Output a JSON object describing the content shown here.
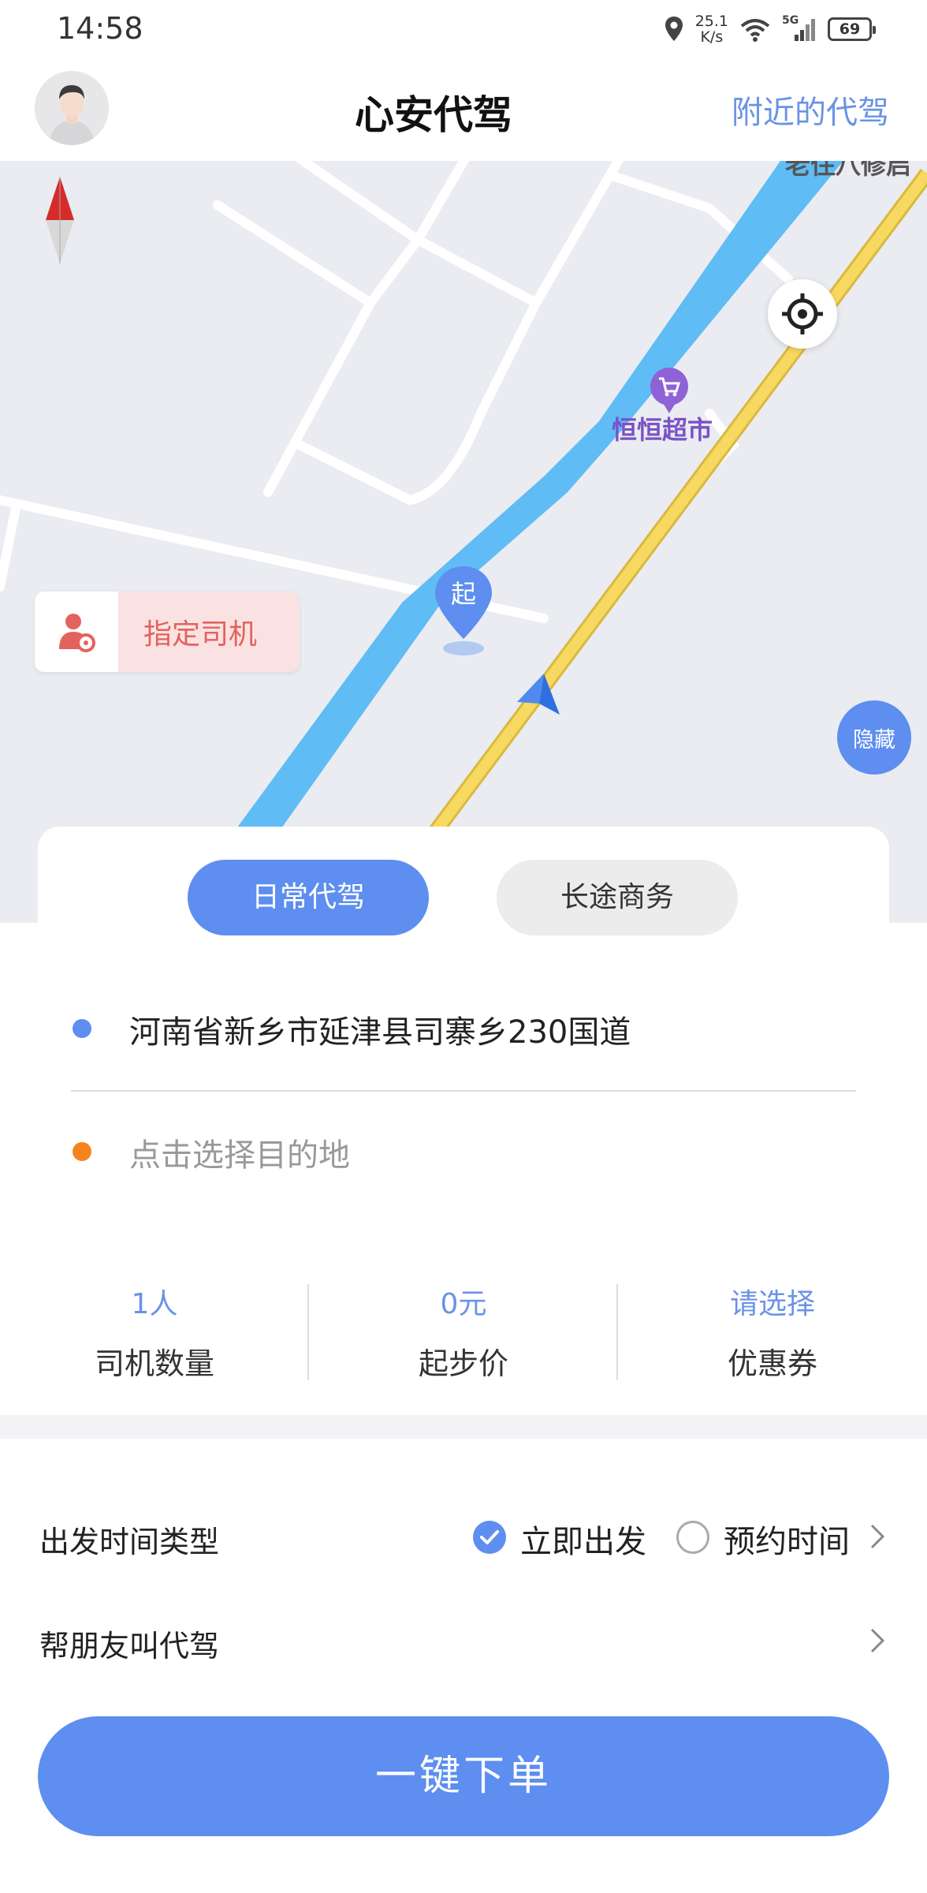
{
  "status_bar": {
    "time": "14:58",
    "net_speed_value": "25.1",
    "net_speed_unit": "K/s",
    "signal_label": "5G",
    "battery": "69",
    "icons": [
      "location-icon",
      "wifi-icon",
      "signal-icon",
      "battery-icon"
    ]
  },
  "header": {
    "title": "心安代驾",
    "nearby_link": "附近的代驾"
  },
  "map": {
    "poi_name": "恒恒超市",
    "edge_place_label": "老住八修启",
    "assign_driver_label": "指定司机",
    "start_marker_label": "起",
    "hide_button_label": "隐藏"
  },
  "booking": {
    "tabs": [
      {
        "label": "日常代驾",
        "active": true
      },
      {
        "label": "长途商务",
        "active": false
      }
    ],
    "start_address": "河南省新乡市延津县司寨乡230国道",
    "destination_placeholder": "点击选择目的地"
  },
  "stats": [
    {
      "value": "1人",
      "label": "司机数量"
    },
    {
      "value": "0元",
      "label": "起步价"
    },
    {
      "value": "请选择",
      "label": "优惠券"
    }
  ],
  "options": {
    "departure_label": "出发时间类型",
    "immediate_label": "立即出发",
    "immediate_selected": true,
    "scheduled_label": "预约时间",
    "friend_label": "帮朋友叫代驾"
  },
  "order_button": "一键下单",
  "colors": {
    "accent": "#5d8ef0",
    "link": "#6b93e4",
    "destination_dot": "#f5841f",
    "assign_bg": "#fbe2e2",
    "assign_text": "#e2635e",
    "river": "#5fbcf5",
    "highway": "#f7d860",
    "poi": "#7a52c6"
  }
}
